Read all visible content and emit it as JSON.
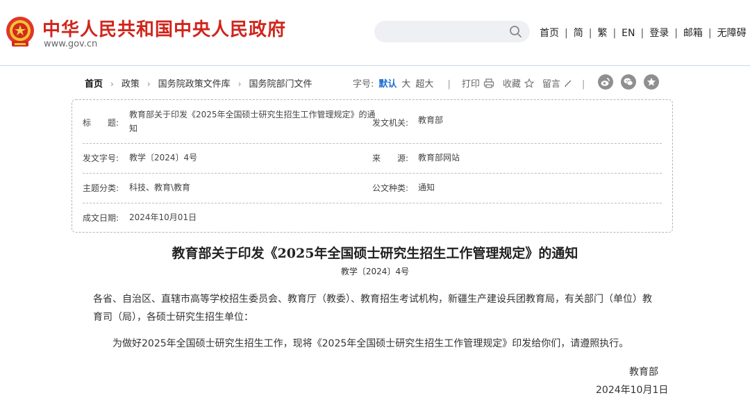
{
  "header": {
    "site_title": "中华人民共和国中央人民政府",
    "site_url": "www.gov.cn",
    "search_placeholder": "",
    "nav": [
      "首页",
      "简",
      "繁",
      "EN",
      "登录",
      "邮箱",
      "无障碍"
    ]
  },
  "breadcrumb": [
    "首页",
    "政策",
    "国务院政策文件库",
    "国务院部门文件"
  ],
  "toolbar": {
    "font_label": "字号:",
    "font_default": "默认",
    "font_large": "大",
    "font_xlarge": "超大",
    "print": "打印",
    "favorite": "收藏",
    "comment": "留言"
  },
  "share_icons": [
    "weibo-icon",
    "wechat-icon",
    "favorite-star-icon"
  ],
  "info": {
    "title_label": "标　　题:",
    "title_value": "教育部关于印发《2025年全国硕士研究生招生工作管理规定》的通知",
    "issuer_label": "发文机关:",
    "issuer_value": "教育部",
    "docno_label": "发文字号:",
    "docno_value": "教学〔2024〕4号",
    "source_label": "来　　源:",
    "source_value": "教育部网站",
    "category_label": "主题分类:",
    "category_value": "科技、教育\\教育",
    "type_label": "公文种类:",
    "type_value": "通知",
    "date_label": "成文日期:",
    "date_value": "2024年10月01日"
  },
  "article": {
    "title": "教育部关于印发《2025年全国硕士研究生招生工作管理规定》的通知",
    "doc_number": "教学〔2024〕4号",
    "recipients": "各省、自治区、直辖市高等学校招生委员会、教育厅（教委）、教育招生考试机构，新疆生产建设兵团教育局，有关部门（单位）教育司（局），各硕士研究生招生单位：",
    "body": "为做好2025年全国硕士研究生招生工作，现将《2025年全国硕士研究生招生工作管理规定》印发给你们，请遵照执行。",
    "signature": "教育部",
    "sign_date": "2024年10月1日"
  },
  "colors": {
    "brand_red": "#d0251c",
    "accent_blue": "#1c6ed4",
    "icon_gray": "#8f8f8f"
  }
}
